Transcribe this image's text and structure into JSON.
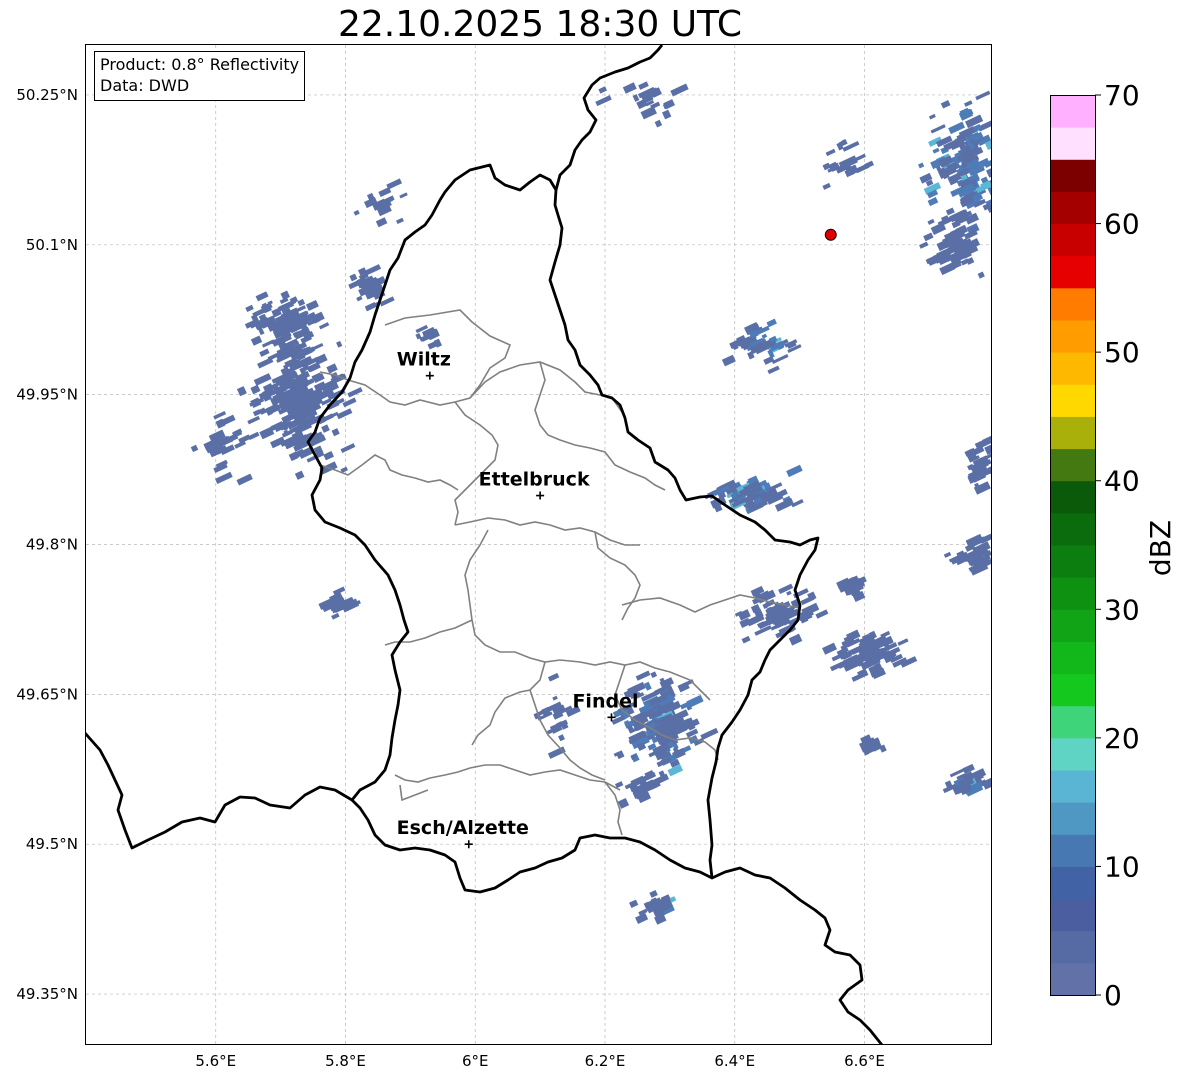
{
  "title": "22.10.2025 18:30 UTC",
  "info": {
    "product": "Product: 0.8° Reflectivity",
    "source": "Data: DWD"
  },
  "lon_ticks": [
    "5.6°E",
    "5.8°E",
    "6°E",
    "6.2°E",
    "6.4°E",
    "6.6°E"
  ],
  "lat_ticks": [
    "50.25°N",
    "50.1°N",
    "49.95°N",
    "49.8°N",
    "49.65°N",
    "49.5°N",
    "49.35°N"
  ],
  "cities": [
    {
      "name": "Wiltz",
      "lon": 5.93,
      "lat": 49.969
    },
    {
      "name": "Ettelbruck",
      "lon": 6.1,
      "lat": 49.849
    },
    {
      "name": "Findel",
      "lon": 6.21,
      "lat": 49.627
    },
    {
      "name": "Esch/Alzette",
      "lon": 5.99,
      "lat": 49.5
    }
  ],
  "radar_site": {
    "lon": 6.548,
    "lat": 50.11,
    "color": "#e00000"
  },
  "extent": {
    "lon_min": 5.4,
    "lon_max": 6.795,
    "lat_min": 49.3,
    "lat_max": 50.3
  },
  "colorbar": {
    "label": "dBZ",
    "ticks": [
      "0",
      "10",
      "20",
      "30",
      "40",
      "50",
      "60",
      "70"
    ],
    "min": 0,
    "max": 70,
    "step": 2.5,
    "colors": [
      "#6272a8",
      "#566aa4",
      "#4a5ea0",
      "#4262a6",
      "#4878b2",
      "#5098c4",
      "#5ab4d4",
      "#60d4c4",
      "#3ed47a",
      "#14c81e",
      "#12b81a",
      "#10a416",
      "#0e9010",
      "#0c7e10",
      "#0a6c0c",
      "#0a5a0a",
      "#447810",
      "#aab00a",
      "#ffd800",
      "#ffb800",
      "#ff9c00",
      "#ff7c00",
      "#e60000",
      "#c80000",
      "#a40000",
      "#7c0000",
      "#ffe0ff",
      "#ffb0ff",
      "#ff70ff",
      "#e838e8"
    ]
  },
  "echo_colors": {
    "weak": "#5a6fa6",
    "mid": "#4e7cb8",
    "strong": "#5ab8d6",
    "core": "#64d2c8"
  }
}
